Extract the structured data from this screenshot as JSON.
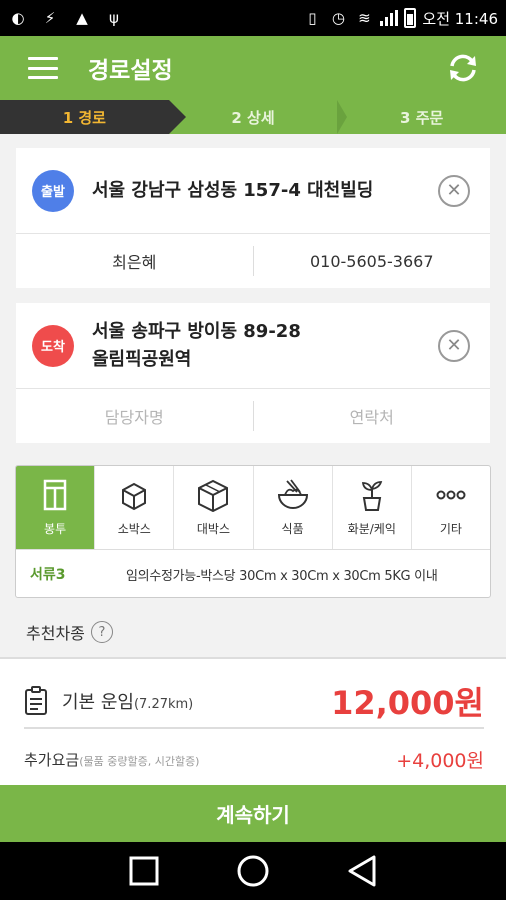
{
  "status_bar": {
    "time_label": "오전 11:46",
    "left_icons": [
      "app-icon-1",
      "app-icon-2",
      "android-icon",
      "usb-icon"
    ],
    "right_icons": [
      "vibrate-icon",
      "alarm-icon",
      "wifi-icon",
      "signal-icon",
      "battery-icon"
    ]
  },
  "app_bar": {
    "title": "경로설정",
    "menu_icon": "hamburger-icon",
    "refresh_icon": "refresh-icon"
  },
  "steps": [
    {
      "label": "1 경로",
      "active": true
    },
    {
      "label": "2 상세",
      "active": false
    },
    {
      "label": "3 주문",
      "active": false
    }
  ],
  "origin": {
    "badge": "출발",
    "address": "서울 강남구 삼성동 157-4 대천빌딩",
    "contact_name": "최은혜",
    "contact_phone": "010-5605-3667"
  },
  "destination": {
    "badge": "도착",
    "address_line1": "서울 송파구 방이동 89-28",
    "address_line2": "올림픽공원역",
    "contact_name_placeholder": "담당자명",
    "contact_phone_placeholder": "연락처"
  },
  "categories": [
    {
      "label": "봉투",
      "icon": "envelope-icon",
      "active": true
    },
    {
      "label": "소박스",
      "icon": "small-box-icon",
      "active": false
    },
    {
      "label": "대박스",
      "icon": "large-box-icon",
      "active": false
    },
    {
      "label": "식품",
      "icon": "food-bowl-icon",
      "active": false
    },
    {
      "label": "화분/케익",
      "icon": "plant-icon",
      "active": false
    },
    {
      "label": "기타",
      "icon": "more-icon",
      "active": false
    }
  ],
  "category_detail": {
    "name": "서류3",
    "description": "임의수정가능-박스당 30Cm x 30Cm x 30Cm 5KG 이내"
  },
  "recommend": {
    "label": "추천차종",
    "help": "?"
  },
  "fare": {
    "label": "기본 운임",
    "distance": "(7.27km)",
    "amount": "12,000원"
  },
  "extra": {
    "label": "추가요금",
    "note": "(물품 중량할증, 시간할증)",
    "amount": "+4,000원"
  },
  "continue_label": "계속하기",
  "colors": {
    "brand_green": "#7ab648",
    "step_active_bg": "#333333",
    "step_active_text": "#f2b632",
    "origin_badge": "#4f7fe8",
    "destination_badge": "#ef4c4c",
    "price_red": "#e8403e"
  }
}
